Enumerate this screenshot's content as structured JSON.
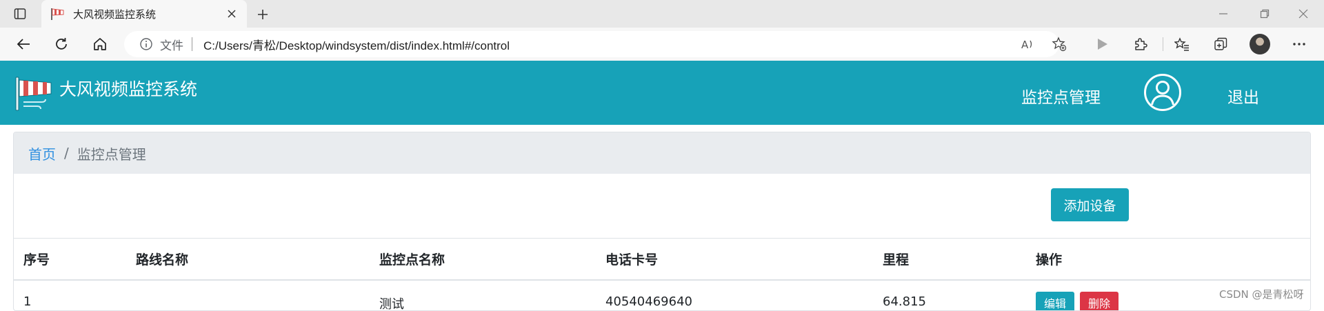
{
  "browser": {
    "tab_title": "大风视频监控系统",
    "address_scheme": "文件",
    "url": "C:/Users/青松/Desktop/windsystem/dist/index.html#/control"
  },
  "header": {
    "brand": "大风视频监控系统",
    "nav_item": "监控点管理",
    "logout": "退出",
    "bg_color": "#17a2b8"
  },
  "breadcrumb": {
    "home": "首页",
    "separator": "/",
    "current": "监控点管理"
  },
  "toolbar": {
    "add_label": "添加设备"
  },
  "table": {
    "headers": [
      "序号",
      "路线名称",
      "监控点名称",
      "电话卡号",
      "里程",
      "操作"
    ],
    "rows": [
      {
        "index": "1",
        "route": "",
        "name": "测试",
        "phone": "40540469640",
        "mileage": "64.815",
        "edit": "编辑",
        "delete": "删除"
      }
    ]
  },
  "watermark": "CSDN @是青松呀",
  "icons": {
    "sidebar_toggle": "tab-actions-icon",
    "favicon": "windsock-icon",
    "close": "close-icon",
    "new_tab": "plus-icon",
    "back": "back-arrow-icon",
    "reload": "reload-icon",
    "home": "home-icon",
    "info": "info-icon",
    "read_aloud": "read-aloud-icon",
    "favorite_add": "star-add-icon",
    "play": "play-icon",
    "extensions": "puzzle-icon",
    "favorites": "favorites-icon",
    "collections": "collections-icon",
    "more": "more-icon",
    "user": "user-circle-icon"
  }
}
